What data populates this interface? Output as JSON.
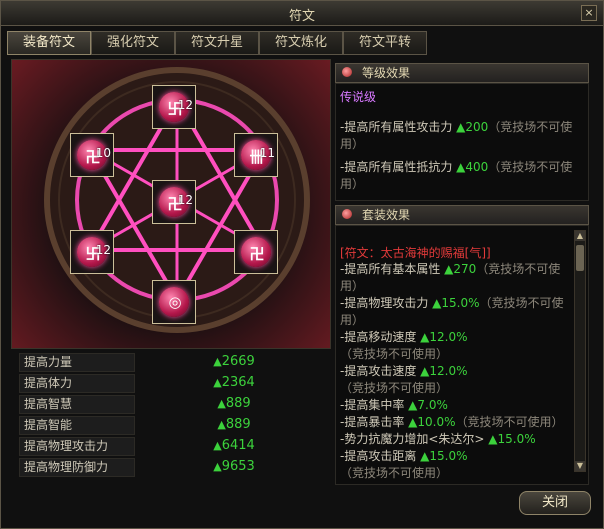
{
  "window": {
    "title": "符文",
    "close_glyph": "×"
  },
  "tabs": [
    {
      "label": "装备符文",
      "active": true
    },
    {
      "label": "强化符文",
      "active": false
    },
    {
      "label": "符文升星",
      "active": false
    },
    {
      "label": "符文炼化",
      "active": false
    },
    {
      "label": "符文平转",
      "active": false
    }
  ],
  "runes": [
    {
      "name": "top",
      "glyph": "卐",
      "level": "12"
    },
    {
      "name": "upper-left",
      "glyph": "卍",
      "level": "10"
    },
    {
      "name": "upper-right",
      "glyph": "卌",
      "level": "11"
    },
    {
      "name": "center",
      "glyph": "卍",
      "level": "12"
    },
    {
      "name": "lower-left",
      "glyph": "卐",
      "level": "12"
    },
    {
      "name": "lower-right",
      "glyph": "卍",
      "level": ""
    },
    {
      "name": "bottom",
      "glyph": "◎",
      "level": ""
    }
  ],
  "stats": [
    {
      "label": "提高力量",
      "value": "2669"
    },
    {
      "label": "提高体力",
      "value": "2364"
    },
    {
      "label": "提高智慧",
      "value": "889"
    },
    {
      "label": "提高智能",
      "value": "889"
    },
    {
      "label": "提高物理攻击力",
      "value": "6414"
    },
    {
      "label": "提高物理防御力",
      "value": "9653"
    }
  ],
  "level_effect": {
    "heading": "等级效果",
    "tier": "传说级",
    "lines": [
      {
        "text": "-提高所有属性攻击力 ",
        "up": "▲200",
        "note": "（竞技场不可使用）"
      },
      {
        "text": "-提高所有属性抵抗力 ",
        "up": "▲400",
        "note": "（竞技场不可使用）"
      }
    ]
  },
  "set_effect": {
    "heading": "套装效果",
    "title": "[符文：太古海神的赐福[气]]",
    "lines": [
      {
        "text": "-提高所有基本属性 ",
        "up": "▲270",
        "note": "（竞技场不可使用）"
      },
      {
        "text": "-提高物理攻击力 ",
        "up": "▲15.0%",
        "note": "（竞技场不可使用）"
      },
      {
        "text": "-提高移动速度 ",
        "up": "▲12.0%",
        "note": "（竞技场不可使用）"
      },
      {
        "text": "-提高攻击速度 ",
        "up": "▲12.0%",
        "note": "（竞技场不可使用）"
      },
      {
        "text": "-提高集中率 ",
        "up": "▲7.0%",
        "note": ""
      },
      {
        "text": "-提高暴击率 ",
        "up": "▲10.0%",
        "note": "（竞技场不可使用）"
      },
      {
        "text": "-势力抗魔力增加<朱达尔> ",
        "up": "▲15.0%",
        "note": ""
      },
      {
        "text": "-提高攻击距离 ",
        "up": "▲15.0%",
        "note": "（竞技场不可使用）"
      }
    ]
  },
  "footer": {
    "close_label": "关闭"
  },
  "colors": {
    "accent_green": "#3cd23c",
    "legend_purple": "#d879ff",
    "set_red": "#e23a3a",
    "ring_pink": "#ff4fbf"
  }
}
